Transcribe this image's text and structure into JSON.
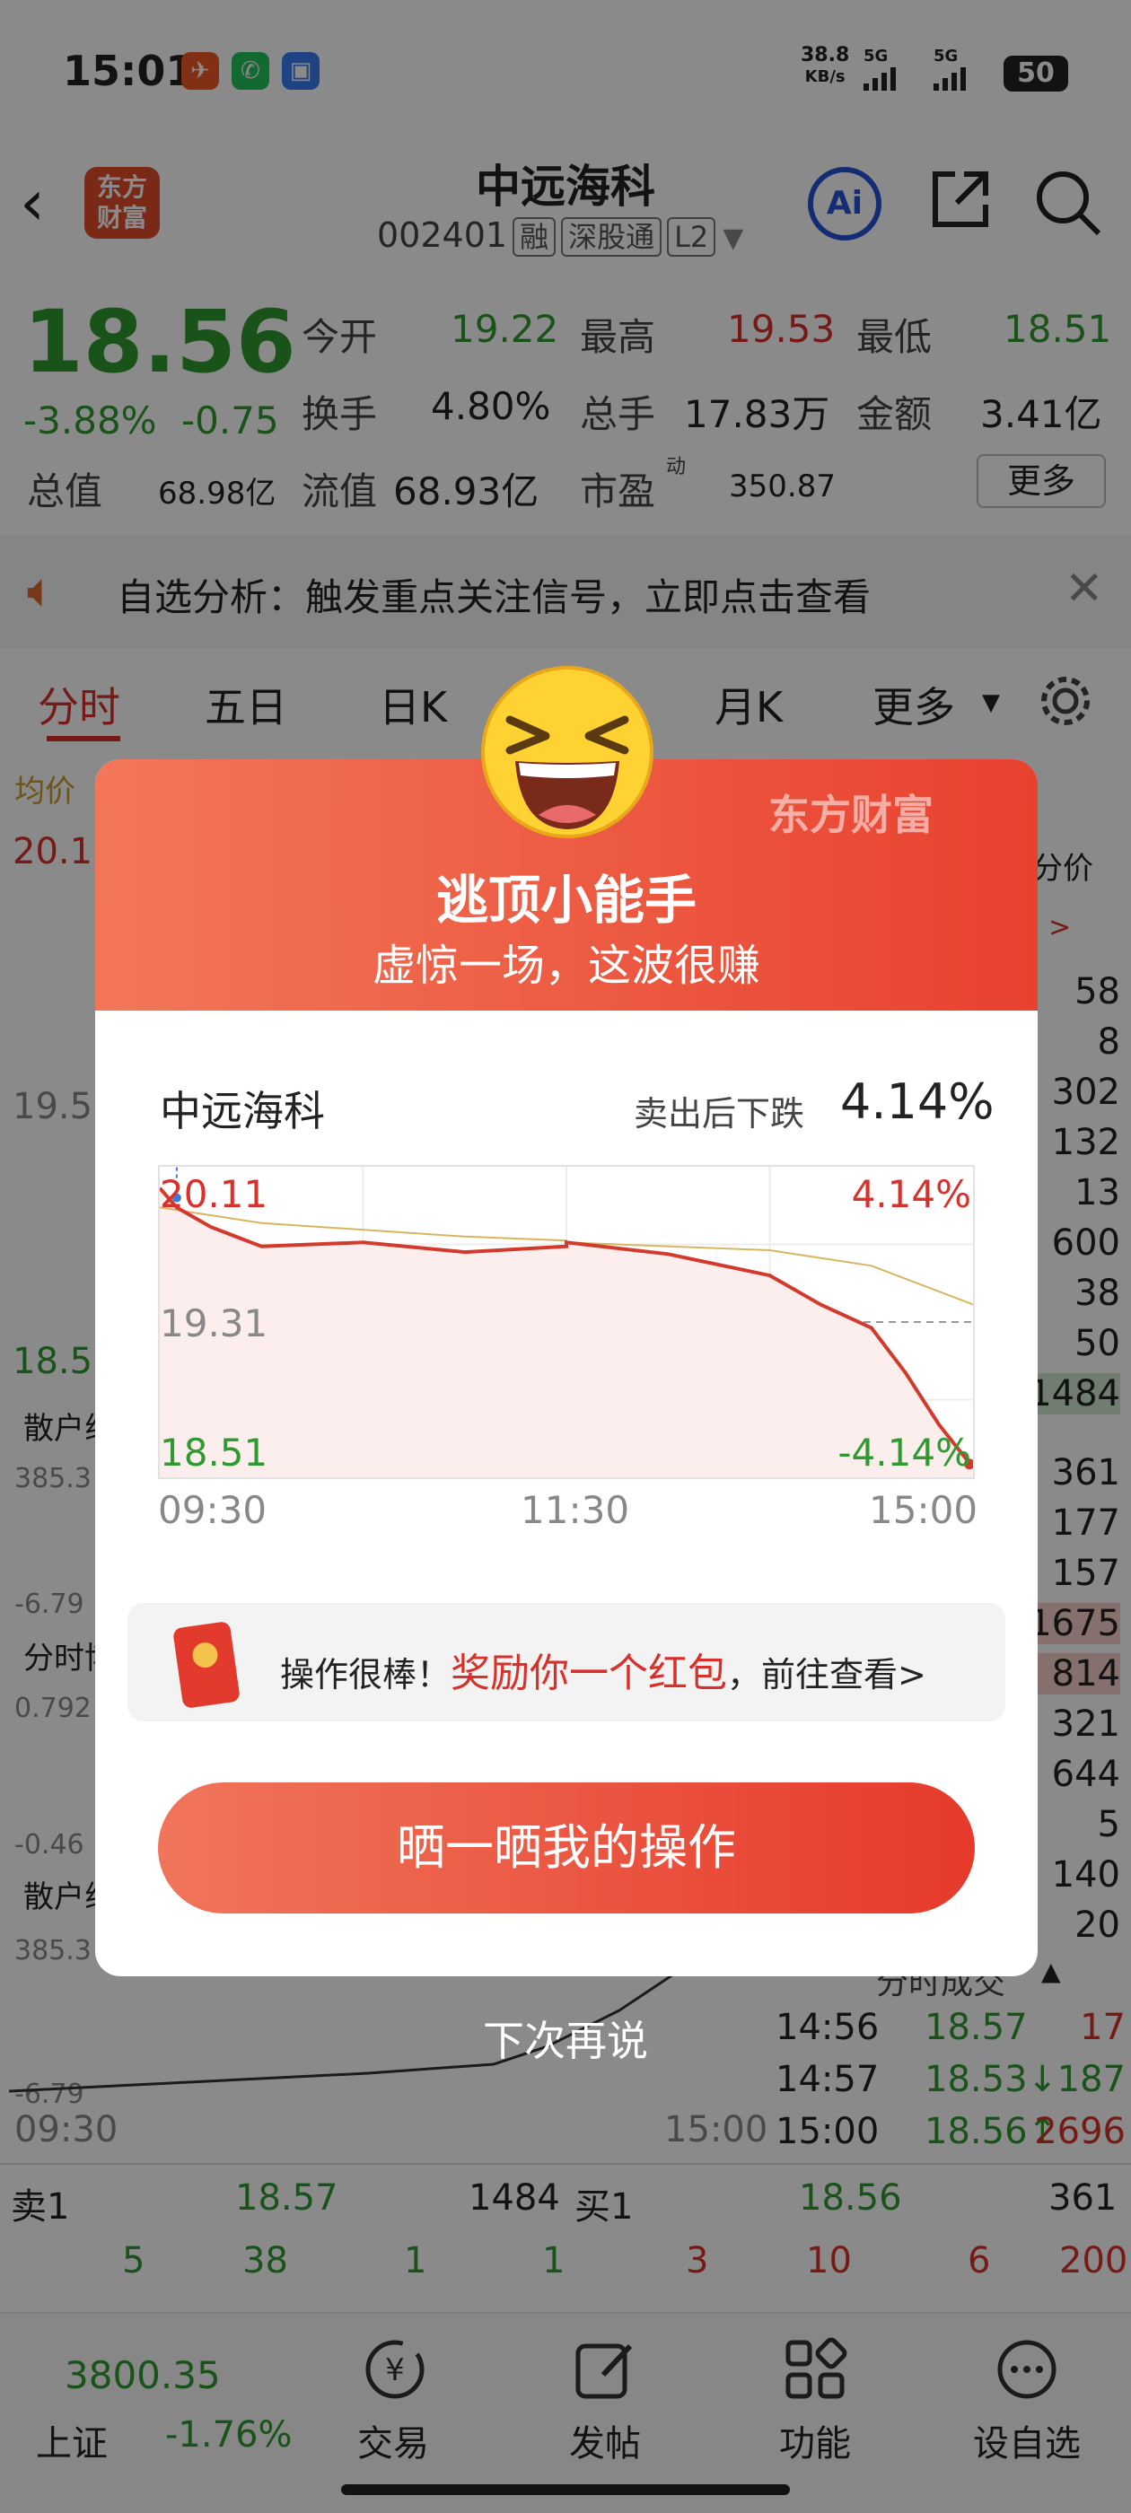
{
  "status": {
    "time": "15:01",
    "net_speed": "38.8",
    "net_unit": "KB/s",
    "sig1": "5G",
    "sig2": "5G",
    "battery": "50"
  },
  "header": {
    "title": "中远海科",
    "code": "002401",
    "tag1": "融",
    "tag2": "深股通",
    "tag3": "L2",
    "logo_line1": "东方",
    "logo_line2": "财富",
    "ai": "Ai"
  },
  "quote": {
    "price": "18.56",
    "pct": "-3.88%",
    "chg": "-0.75",
    "open_label": "今开",
    "open": "19.22",
    "high_label": "最高",
    "high": "19.53",
    "low_label": "最低",
    "low": "18.51",
    "turn_label": "换手",
    "turn": "4.80%",
    "vol_label": "总手",
    "vol": "17.83万",
    "amt_label": "金额",
    "amt": "3.41亿",
    "mcap_label": "总值",
    "mcap": "68.98亿",
    "float_label": "流值",
    "float": "68.93亿",
    "pe_label": "市盈",
    "pe_sup": "动",
    "pe": "350.87",
    "more": "更多"
  },
  "banner": {
    "text": "自选分析：触发重点关注信号，立即点击查看"
  },
  "tabs": [
    "分时",
    "五日",
    "日K",
    "",
    "月K",
    "更多"
  ],
  "chart_bg": {
    "avg_label": "均价",
    "top": "20.11",
    "mid": "19.5",
    "bottom": "18.51",
    "retail1": "散户线",
    "v1": "385.3",
    "v2": "-6.79",
    "game": "分时博弈",
    "v3": "0.792",
    "v4": "-0.46",
    "retail2": "散户线",
    "v5": "385.3",
    "v6": "-6.79",
    "t_start": "09:30",
    "t_end": "15:00",
    "price_col": "分价"
  },
  "right_list": [
    "58",
    "8",
    "302",
    "132",
    "13",
    "600",
    "38",
    "50",
    "1484",
    "361",
    "177",
    "157",
    "1675",
    "814",
    "321",
    "644",
    "5",
    "140",
    "20"
  ],
  "trades_label": "分时成交",
  "trades": [
    {
      "t": "14:56",
      "p": "18.57",
      "v": "17"
    },
    {
      "t": "14:57",
      "p": "18.53↓",
      "v": "187"
    },
    {
      "t": "15:00",
      "p": "18.56↑",
      "v": "2696"
    }
  ],
  "orderbook": {
    "sell_label": "卖1",
    "sell_price": "18.57",
    "sell_vol": "1484",
    "sell_row": [
      "5",
      "38",
      "1",
      "1"
    ],
    "buy_label": "买1",
    "buy_price": "18.56",
    "buy_vol": "361",
    "buy_row": [
      "3",
      "10",
      "6",
      "200"
    ]
  },
  "bottom_nav": {
    "index_value": "3800.35",
    "index_name": "上证",
    "index_pct": "-1.76%",
    "items": [
      "交易",
      "发帖",
      "功能",
      "设自选"
    ]
  },
  "modal": {
    "title": "逃顶小能手",
    "subtitle": "虚惊一场，这波很赚",
    "watermark": "东方财富",
    "stock": "中远海科",
    "drop_label": "卖出后下跌",
    "drop": "4.14%",
    "reward_prefix": "操作很棒！",
    "reward_highlight": "奖励你一个红包",
    "reward_suffix": "，前往查看>",
    "share_button": "晒一晒我的操作",
    "later": "下次再说"
  },
  "chart_data": {
    "type": "line",
    "title": "中远海科",
    "x_ticks": [
      "09:30",
      "11:30",
      "15:00"
    ],
    "ylim": [
      18.51,
      20.11
    ],
    "y_labels": [
      "20.11",
      "19.31",
      "18.51"
    ],
    "pct_labels": [
      "4.14%",
      "-4.14%"
    ],
    "reference": 19.31,
    "sell_marker": {
      "label": "S",
      "x": "09:35",
      "y": 19.95
    },
    "series": [
      {
        "color": "#d33a2c",
        "x": [
          "09:30",
          "09:35",
          "09:45",
          "10:00",
          "10:30",
          "11:00",
          "11:30",
          "13:00",
          "13:30",
          "14:00",
          "14:15",
          "14:30",
          "14:40",
          "14:50",
          "15:00"
        ],
        "values": [
          20.0,
          19.9,
          19.8,
          19.7,
          19.72,
          19.67,
          19.7,
          19.72,
          19.66,
          19.55,
          19.4,
          19.28,
          19.05,
          18.78,
          18.56
        ]
      },
      {
        "color": "#d8b560",
        "x": [
          "09:30",
          "10:00",
          "11:00",
          "11:30",
          "13:00",
          "14:00",
          "14:30",
          "15:00"
        ],
        "values": [
          19.9,
          19.82,
          19.75,
          19.73,
          19.72,
          19.68,
          19.6,
          19.4
        ]
      }
    ],
    "grid": true
  }
}
